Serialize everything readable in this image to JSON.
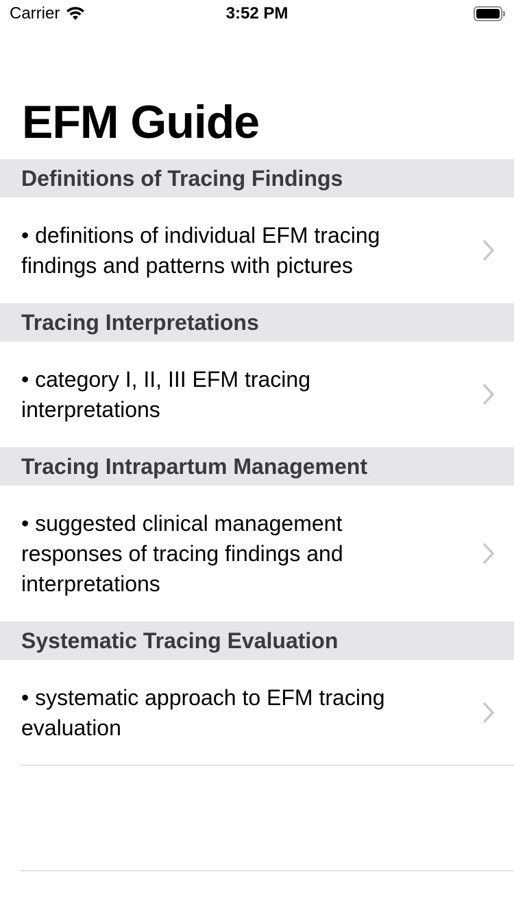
{
  "status_bar": {
    "carrier": "Carrier",
    "time": "3:52 PM",
    "wifi_icon": "wifi-icon",
    "battery_icon": "battery-icon"
  },
  "nav": {
    "title": "EFM Guide"
  },
  "sections": [
    {
      "header": "Definitions of Tracing Findings",
      "cell_text": "• definitions of individual EFM tracing findings and patterns with pictures"
    },
    {
      "header": "Tracing Interpretations",
      "cell_text": "• category I, II, III EFM tracing interpretations"
    },
    {
      "header": "Tracing Intrapartum Management",
      "cell_text": "• suggested clinical management responses of tracing findings and interpretations"
    },
    {
      "header": "Systematic Tracing Evaluation",
      "cell_text": "• systematic approach to EFM tracing evaluation"
    }
  ],
  "colors": {
    "section_header_bg": "#e5e5ea",
    "chevron": "#c7c7cc",
    "separator": "#c8c7cc"
  }
}
